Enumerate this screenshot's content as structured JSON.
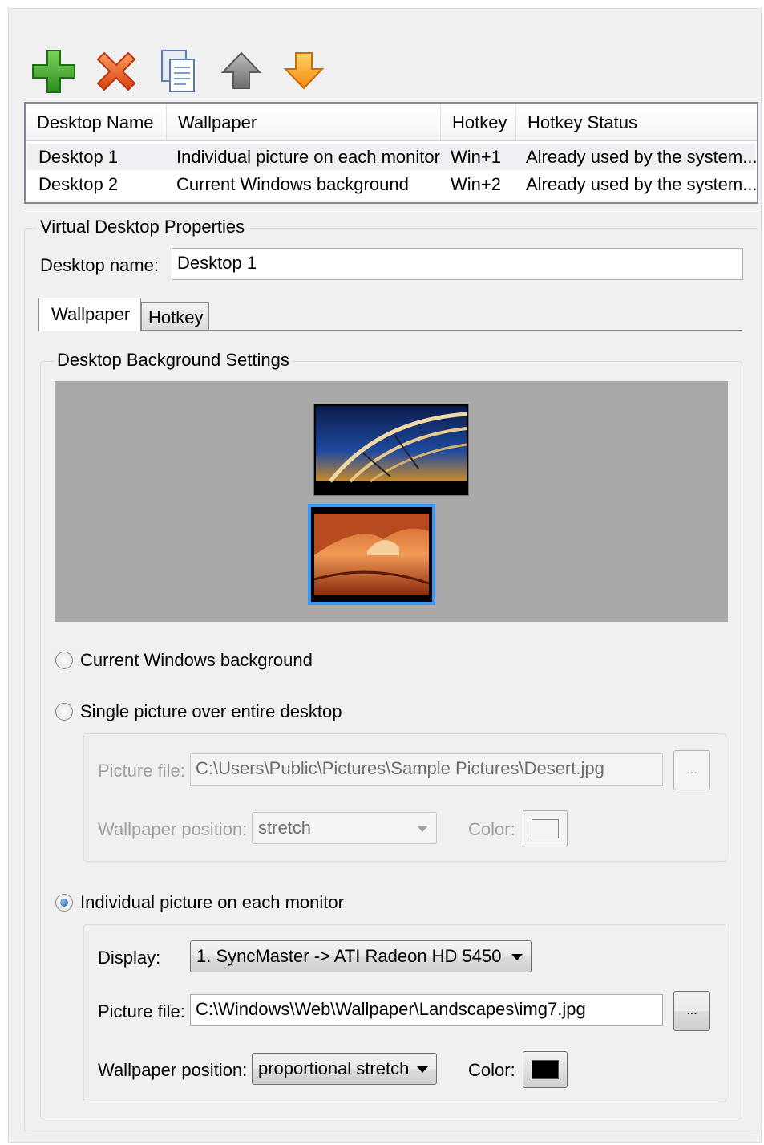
{
  "toolbar": {
    "buttons": [
      {
        "icon": "add-icon",
        "color": "#3aa532"
      },
      {
        "icon": "delete-icon",
        "color": "#e2561c"
      },
      {
        "icon": "copy-icon",
        "color": "#6b8fc6"
      },
      {
        "icon": "move-up-icon",
        "color": "#8c8c8c"
      },
      {
        "icon": "move-down-icon",
        "color": "#f5a21b"
      }
    ]
  },
  "desktop_list": {
    "columns": [
      "Desktop Name",
      "Wallpaper",
      "Hotkey",
      "Hotkey Status"
    ],
    "rows": [
      {
        "name": "Desktop 1",
        "wallpaper": "Individual picture on each monitor",
        "hotkey": "Win+1",
        "status": "Already used by the system..."
      },
      {
        "name": "Desktop 2",
        "wallpaper": "Current Windows background",
        "hotkey": "Win+2",
        "status": "Already used by the system..."
      }
    ]
  },
  "properties": {
    "title": "Virtual Desktop Properties",
    "name_label": "Desktop name:",
    "name_value": "Desktop 1",
    "tabs": [
      "Wallpaper",
      "Hotkey"
    ]
  },
  "background": {
    "title": "Desktop Background Settings",
    "options": {
      "current": "Current Windows background",
      "single": "Single picture over entire desktop",
      "individual": "Individual picture on each monitor"
    },
    "selected_option": "individual",
    "single": {
      "picture_label": "Picture file:",
      "picture_value": "C:\\Users\\Public\\Pictures\\Sample Pictures\\Desert.jpg",
      "browse": "...",
      "position_label": "Wallpaper position:",
      "position_value": "stretch",
      "color_label": "Color:",
      "color": "#f4f4f4"
    },
    "individual": {
      "display_label": "Display:",
      "display_value": "1. SyncMaster -> ATI Radeon HD 5450",
      "picture_label": "Picture file:",
      "picture_value": "C:\\Windows\\Web\\Wallpaper\\Landscapes\\img7.jpg",
      "browse": "...",
      "position_label": "Wallpaper position:",
      "position_value": "proportional stretch",
      "color_label": "Color:",
      "color": "#000000"
    }
  },
  "colors": {
    "preview_bg": "#a9a9a9",
    "selected_monitor": "#3399ff"
  }
}
